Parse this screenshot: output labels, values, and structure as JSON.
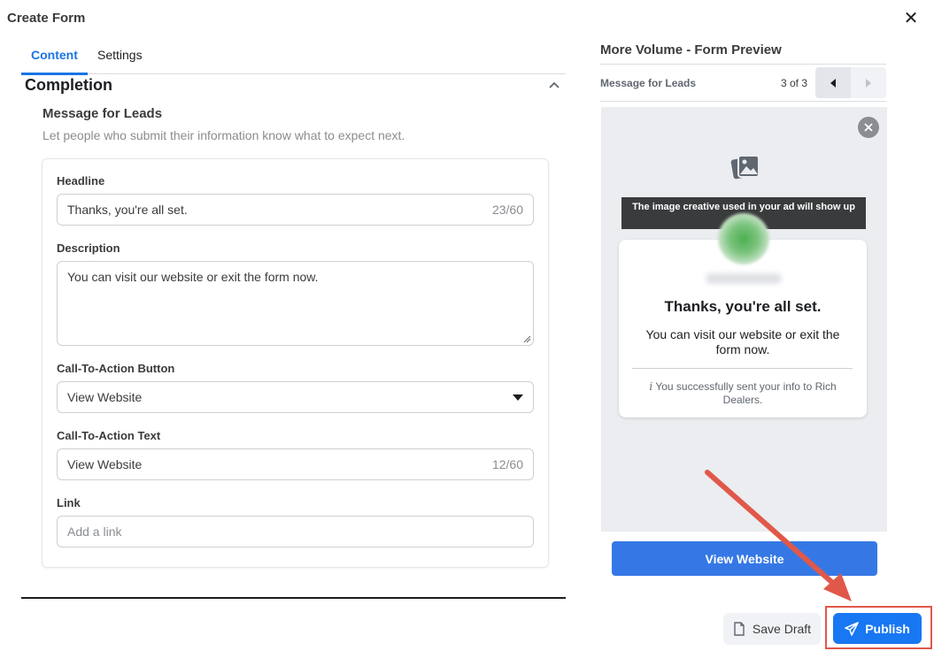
{
  "dialog": {
    "title": "Create Form"
  },
  "tabs": [
    {
      "label": "Content",
      "active": true
    },
    {
      "label": "Settings",
      "active": false
    }
  ],
  "section": {
    "title": "Completion",
    "subtitle": "Message for Leads",
    "help": "Let people who submit their information know what to expect next."
  },
  "fields": {
    "headline": {
      "label": "Headline",
      "value": "Thanks, you're all set.",
      "count": "23/60"
    },
    "description": {
      "label": "Description",
      "value": "You can visit our website or exit the form now."
    },
    "cta_button": {
      "label": "Call-To-Action Button",
      "value": "View Website"
    },
    "cta_text": {
      "label": "Call-To-Action Text",
      "value": "View Website",
      "count": "12/60"
    },
    "link": {
      "label": "Link",
      "placeholder": "Add a link"
    }
  },
  "preview": {
    "title": "More Volume - Form Preview",
    "screen_name": "Message for Leads",
    "page_indicator": "3 of 3",
    "creative_notice": "The image creative used in your ad will show up",
    "headline": "Thanks, you're all set.",
    "description": "You can visit our website or exit the form now.",
    "info": "You successfully sent your info to Rich Dealers.",
    "cta_label": "View Website"
  },
  "footer": {
    "save_draft_label": "Save Draft",
    "publish_label": "Publish"
  },
  "colors": {
    "accent": "#1877f2",
    "annotation_red": "#e0584a"
  }
}
